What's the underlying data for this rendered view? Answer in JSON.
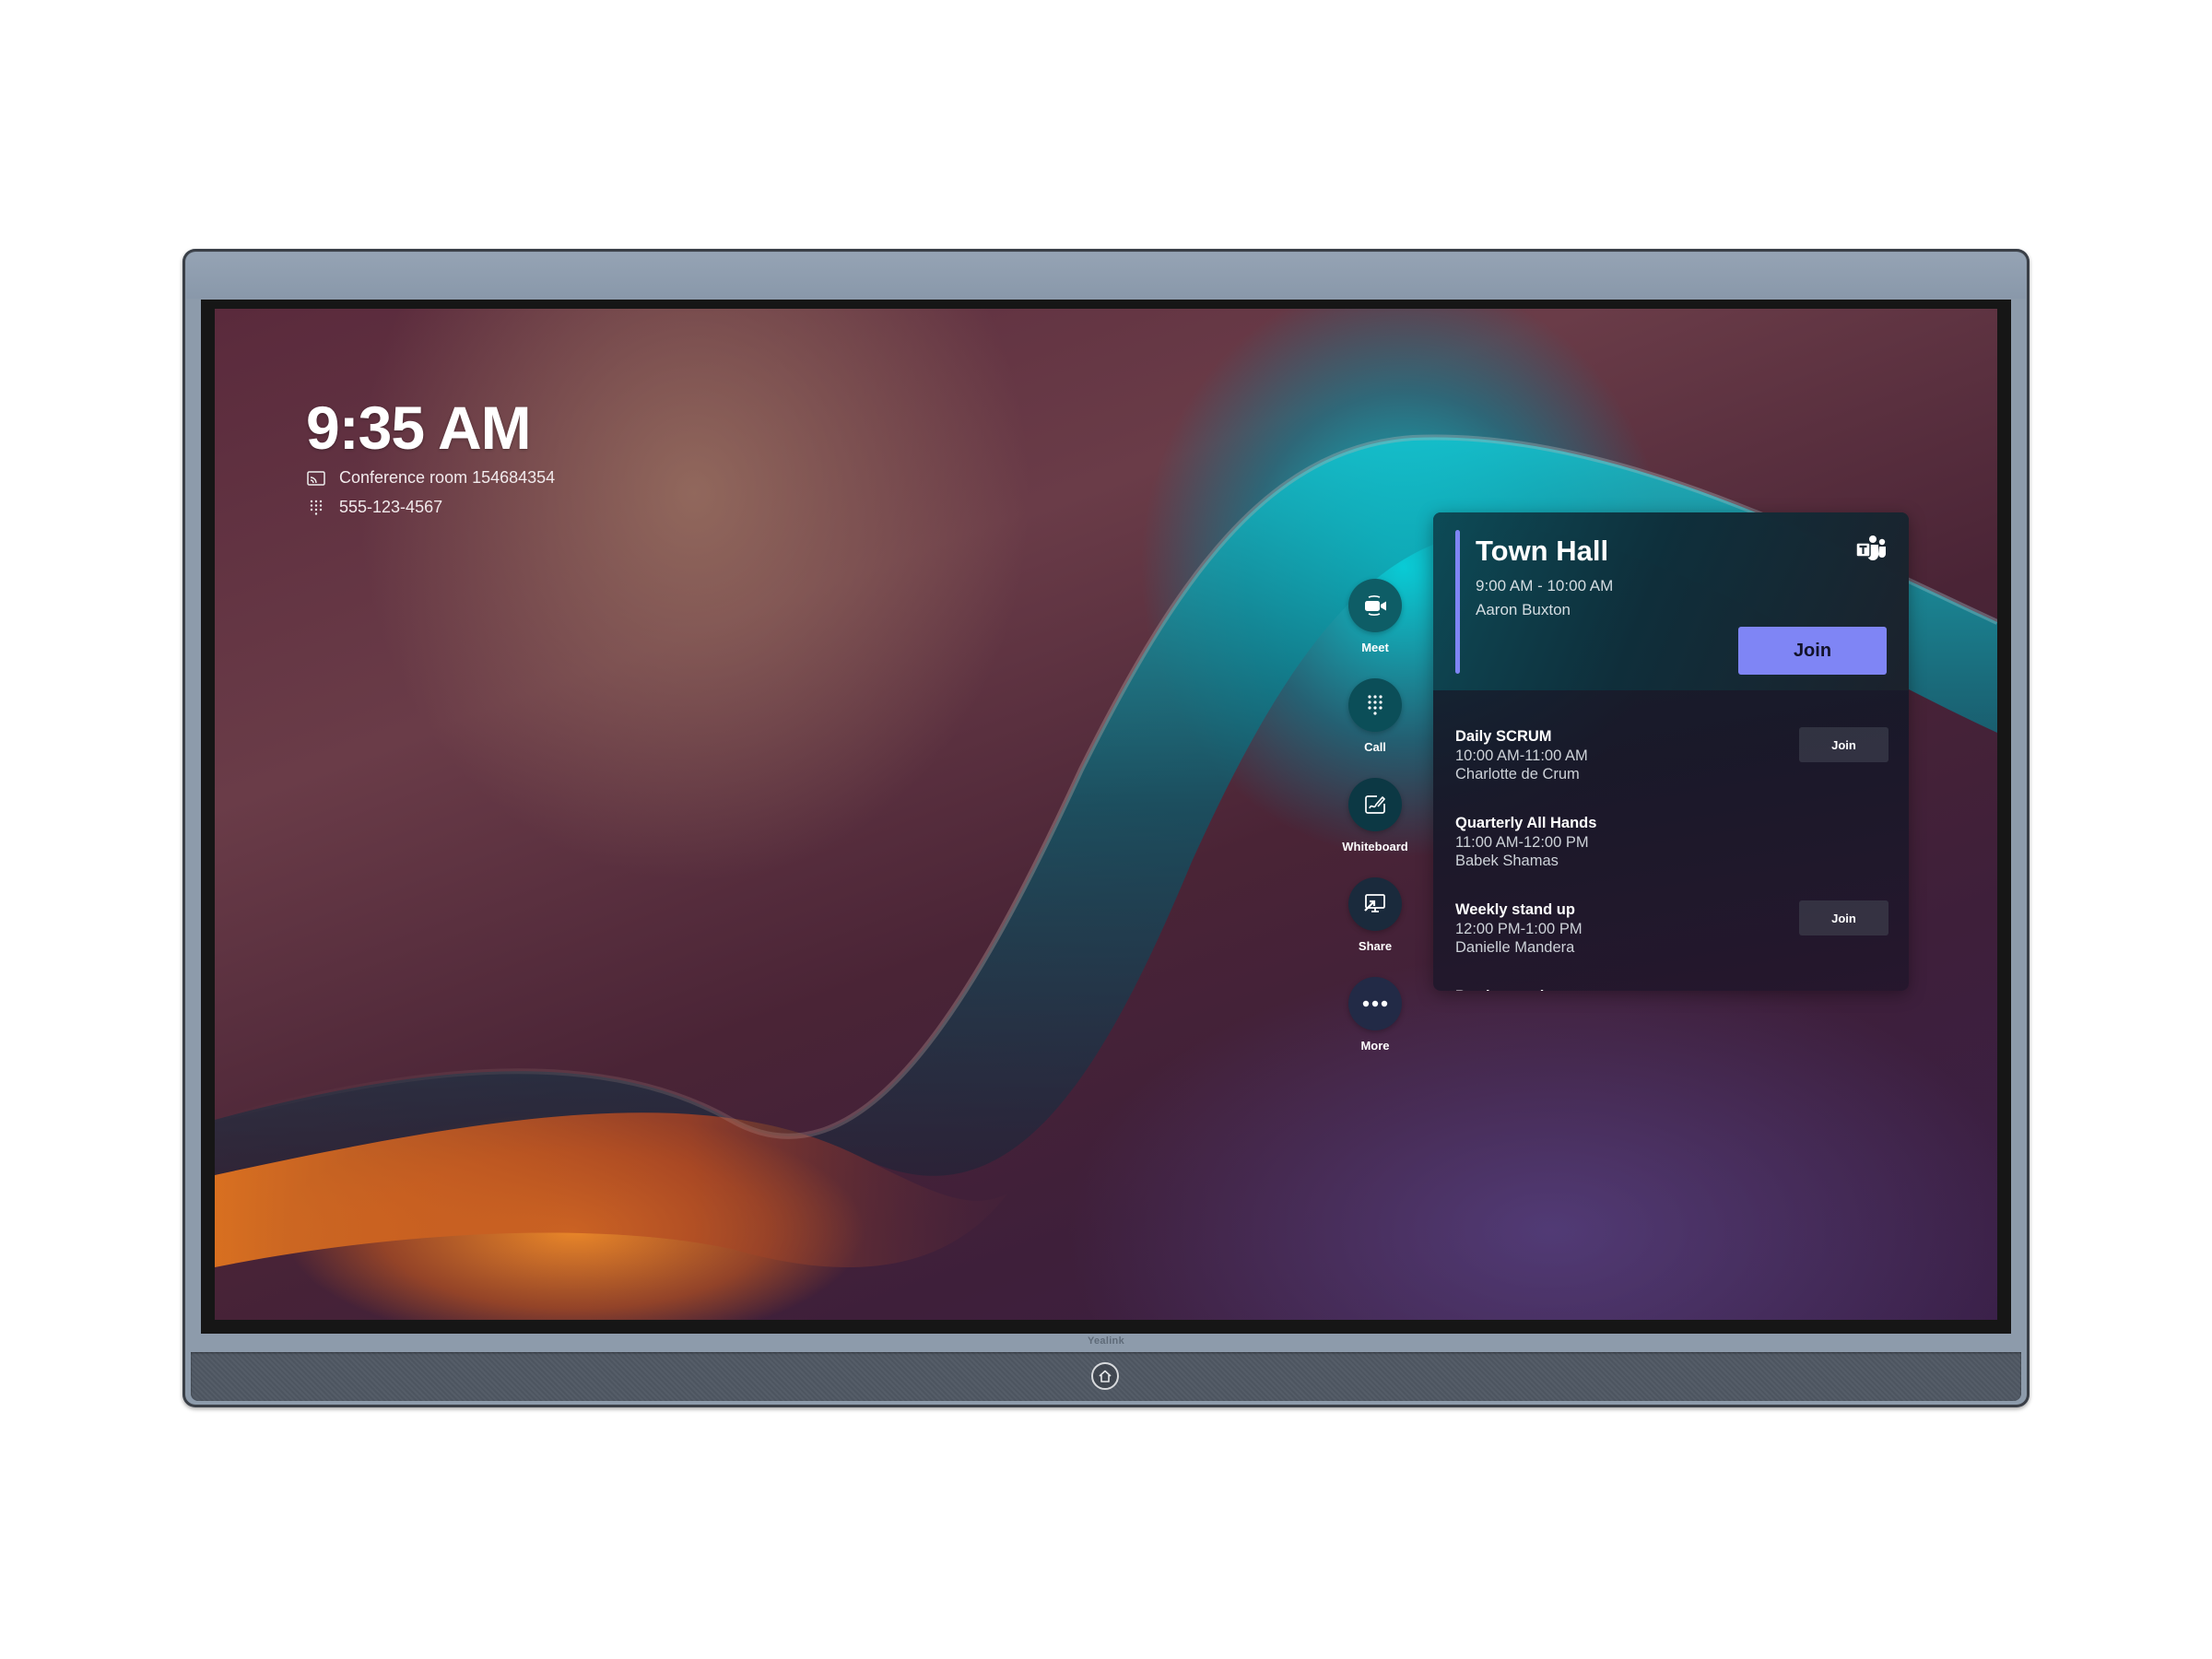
{
  "device": {
    "brand": "Yealink"
  },
  "home": {
    "clock": "9:35 AM",
    "room_name": "Conference room 154684354",
    "phone_number": "555-123-4567"
  },
  "actions": [
    {
      "id": "meet",
      "label": "Meet",
      "icon": "video-camera-icon"
    },
    {
      "id": "call",
      "label": "Call",
      "icon": "dialpad-icon"
    },
    {
      "id": "whiteboard",
      "label": "Whiteboard",
      "icon": "whiteboard-icon"
    },
    {
      "id": "share",
      "label": "Share",
      "icon": "share-screen-icon"
    },
    {
      "id": "more",
      "label": "More",
      "icon": "more-icon"
    }
  ],
  "meetings": {
    "featured": {
      "title": "Town Hall",
      "time": "9:00 AM - 10:00 AM",
      "organizer": "Aaron Buxton",
      "join_label": "Join",
      "app_icon": "teams-icon"
    },
    "list": [
      {
        "title": "Daily SCRUM",
        "time": "10:00 AM-11:00 AM",
        "organizer": "Charlotte de Crum",
        "join_label": "Join"
      },
      {
        "title": "Quarterly All Hands",
        "time": "11:00 AM-12:00 PM",
        "organizer": "Babek Shamas",
        "join_label": null
      },
      {
        "title": "Weekly stand up",
        "time": "12:00 PM-1:00 PM",
        "organizer": "Danielle Mandera",
        "join_label": "Join"
      },
      {
        "title": "Product review",
        "time": "",
        "organizer": "",
        "join_label": ""
      }
    ]
  },
  "colors": {
    "accent": "#7f85f5",
    "frame": "#8d9bab"
  }
}
